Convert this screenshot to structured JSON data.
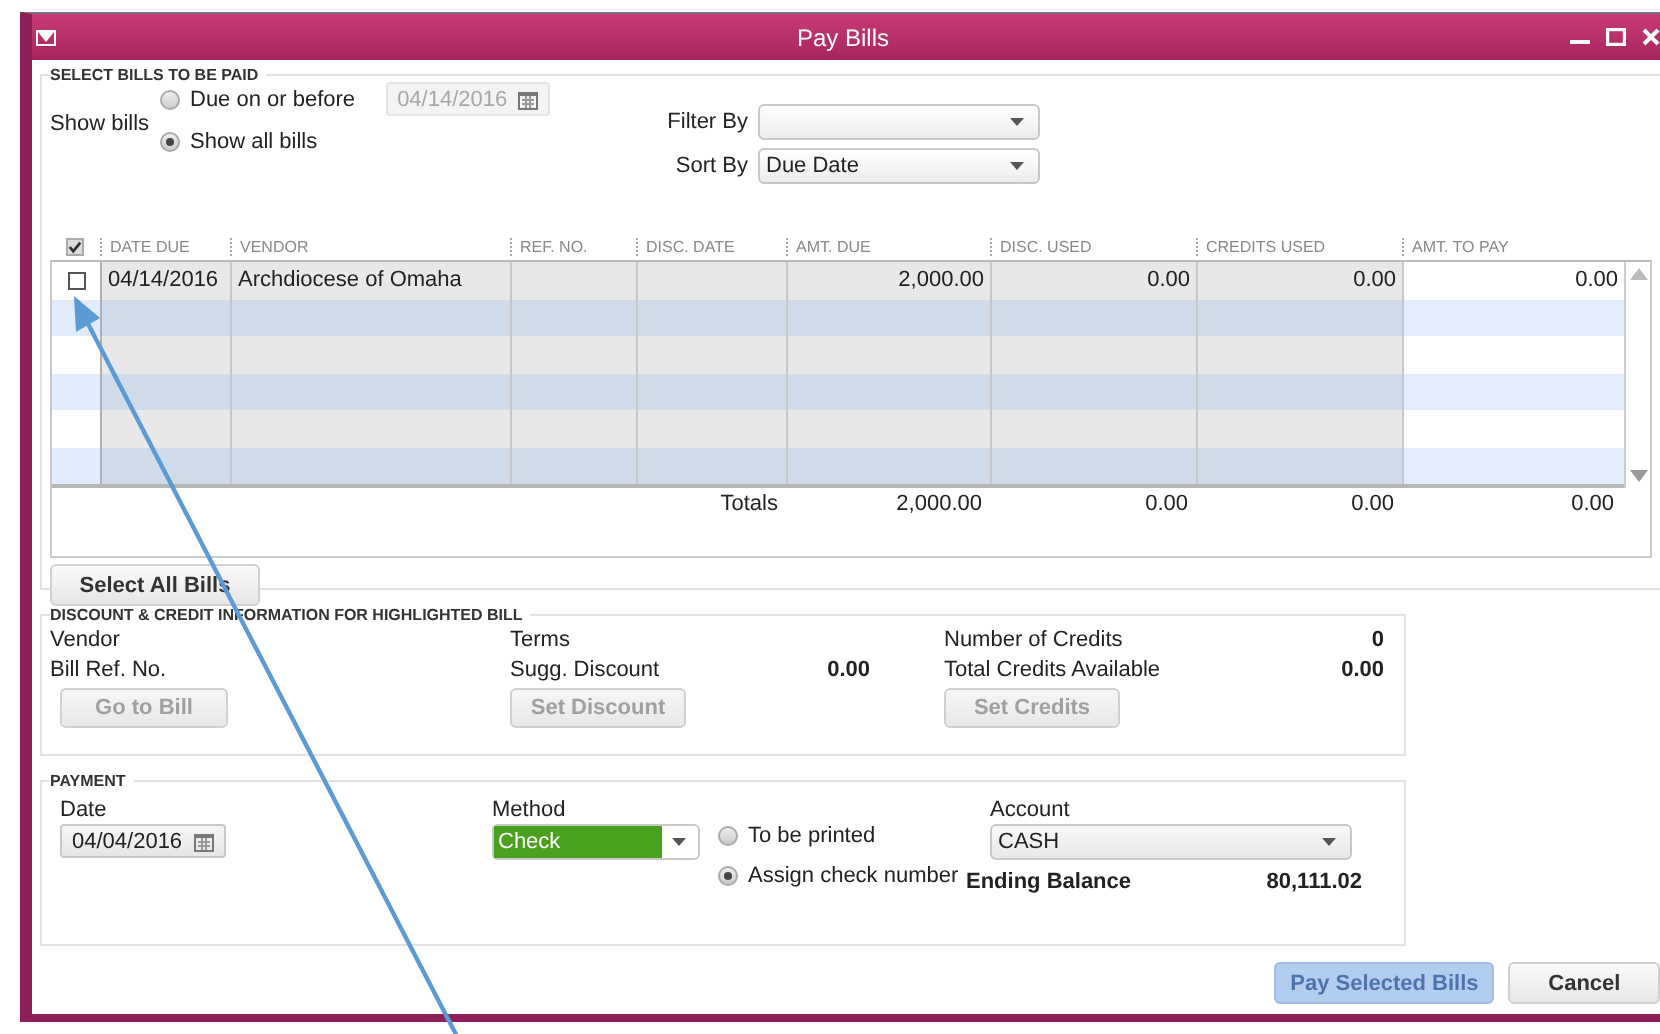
{
  "window": {
    "title": "Pay Bills"
  },
  "select_bills": {
    "heading": "SELECT BILLS TO BE PAID",
    "show_bills_label": "Show bills",
    "options": [
      {
        "label": "Due on or before",
        "selected": false
      },
      {
        "label": "Show all bills",
        "selected": true
      }
    ],
    "due_date": {
      "value": "04/14/2016",
      "disabled": true
    },
    "filter_by": {
      "label": "Filter By"
    },
    "sort_by": {
      "label": "Sort By",
      "value": "Due Date"
    }
  },
  "table": {
    "header_checked": true,
    "columns": [
      "DATE DUE",
      "VENDOR",
      "REF. NO.",
      "DISC. DATE",
      "AMT. DUE",
      "DISC. USED",
      "CREDITS USED",
      "AMT. TO PAY"
    ],
    "rows": [
      {
        "checked": false,
        "date_due": "04/14/2016",
        "vendor": "Archdiocese of Omaha",
        "amt_due": "2,000.00",
        "disc_used": "0.00",
        "credits_used": "0.00",
        "amt_to_pay": "0.00"
      }
    ],
    "totals": {
      "label": "Totals",
      "amt_due": "2,000.00",
      "disc_used": "0.00",
      "credits_used": "0.00",
      "amt_to_pay": "0.00"
    }
  },
  "select_all_button": {
    "label": "Select All Bills",
    "disabled": false
  },
  "discount_credit": {
    "heading": "DISCOUNT & CREDIT INFORMATION FOR HIGHLIGHTED BILL",
    "vendor_label": "Vendor",
    "bill_ref_label": "Bill Ref. No.",
    "terms_label": "Terms",
    "sugg_discount": {
      "label": "Sugg. Discount",
      "value": "0.00"
    },
    "number_of_credits": {
      "label": "Number of Credits",
      "value": "0"
    },
    "total_credits": {
      "label": "Total Credits Available",
      "value": "0.00"
    },
    "buttons": [
      {
        "label": "Go to Bill",
        "disabled": true
      },
      {
        "label": "Set Discount",
        "disabled": true
      },
      {
        "label": "Set Credits",
        "disabled": true
      }
    ]
  },
  "payment": {
    "heading": "PAYMENT",
    "date": {
      "label": "Date",
      "value": "04/04/2016"
    },
    "method": {
      "label": "Method",
      "value": "Check"
    },
    "print_options": [
      {
        "label": "To be printed",
        "selected": false
      },
      {
        "label": "Assign check number",
        "selected": true
      }
    ],
    "account": {
      "label": "Account",
      "value": "CASH"
    },
    "ending_balance": {
      "label": "Ending Balance",
      "value": "80,111.02"
    }
  },
  "buttons": [
    {
      "label": "Pay Selected Bills",
      "disabled": true
    },
    {
      "label": "Cancel",
      "disabled": false
    }
  ]
}
